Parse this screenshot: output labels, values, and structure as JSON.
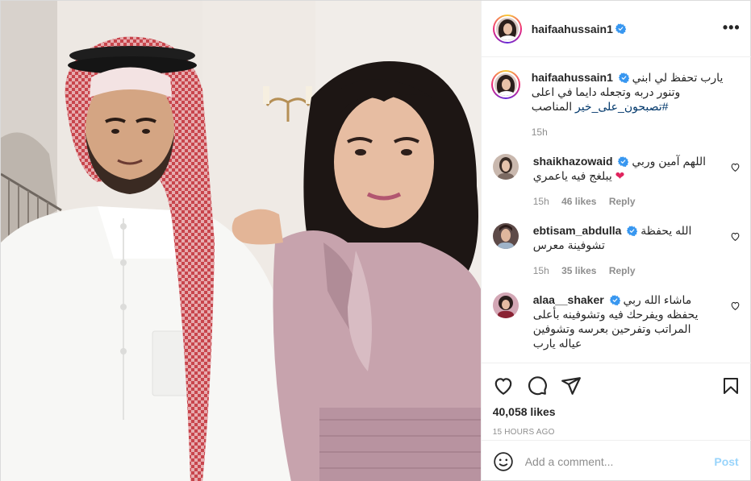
{
  "post": {
    "author": "haifaahussain1",
    "more_label": "•••",
    "caption": {
      "username": "haifaahussain1",
      "line1": "يارب تحفظ لي ابني",
      "line2": "وتنور دربه وتجعله دايما في اعلى",
      "line3": "المناصب",
      "hashtag": "#تصبحون_على_خير",
      "time": "15h"
    },
    "comments": [
      {
        "username": "shaikhazowaid",
        "text1": "اللهم آمين وربي",
        "text2": "يبلغج فيه ياعمري",
        "time": "15h",
        "likes": "46 likes",
        "reply": "Reply"
      },
      {
        "username": "ebtisam_abdulla",
        "text1": "الله يحفظة",
        "text2": "تشوفينة معرس",
        "time": "15h",
        "likes": "35 likes",
        "reply": "Reply"
      },
      {
        "username": "alaa__shaker",
        "text1": "ماشاء الله ربي",
        "text2": "يحفظه ويفرحك فيه وتشوفينه بأعلى",
        "text3": "المراتب وتفرحين بعرسه وتشوفين",
        "text4": "عياله يارب"
      }
    ],
    "like_count": "40,058 likes",
    "posted_ago": "15 HOURS AGO",
    "add_comment_placeholder": "Add a comment...",
    "post_button": "Post"
  },
  "icons": {
    "verified": "verified-badge-icon",
    "like": "heart-icon",
    "comment": "comment-icon",
    "share": "paper-plane-icon",
    "save": "bookmark-icon",
    "emoji": "smiley-icon",
    "more": "more-options-icon"
  },
  "colors": {
    "verified_blue": "#3897f0",
    "link_blue": "#00376b",
    "post_blue": "#0095f6",
    "muted_gray": "#8e8e8e",
    "red_heart": "#e0245e"
  }
}
